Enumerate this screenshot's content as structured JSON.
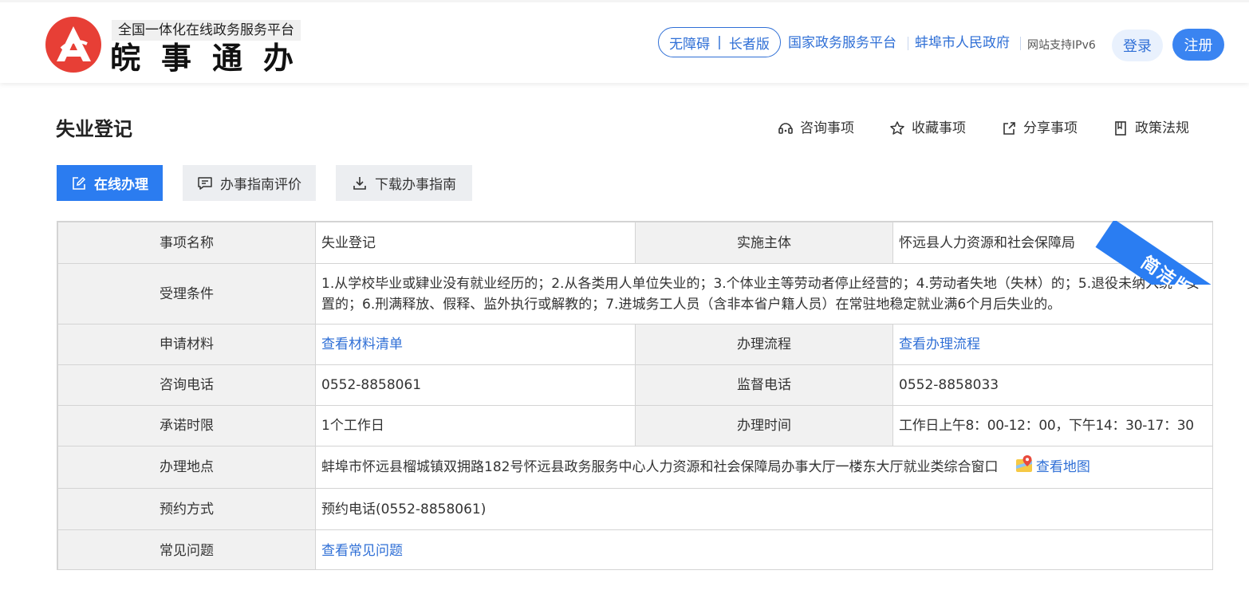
{
  "header": {
    "platform_tag": "全国一体化在线政务服务平台",
    "brand": "皖事通办",
    "accessibility": "无障碍",
    "elder_mode": "长者版",
    "national_platform": "国家政务服务平台",
    "city_gov": "蚌埠市人民政府",
    "ipv6": "网站支持IPv6",
    "login": "登录",
    "register": "注册",
    "brand_color": "#e73f36",
    "accent_color": "#2f6fd6"
  },
  "page": {
    "title": "失业登记",
    "actions": {
      "consult": "咨询事项",
      "favorite": "收藏事项",
      "share": "分享事项",
      "policy": "政策法规"
    },
    "buttons": {
      "online": "在线办理",
      "evaluate": "办事指南评价",
      "download": "下载办事指南"
    },
    "ribbon": "简洁版"
  },
  "table": {
    "item_name_label": "事项名称",
    "item_name": "失业登记",
    "agency_label": "实施主体",
    "agency": "怀远县人力资源和社会保障局",
    "conditions_label": "受理条件",
    "conditions": "1.从学校毕业或肄业没有就业经历的；2.从各类用人单位失业的；3.个体业主等劳动者停止经营的；4.劳动者失地（失林）的；5.退役未纳入统一安置的；6.刑满释放、假释、监外执行或解教的；7.进城务工人员（含非本省户籍人员）在常驻地稳定就业满6个月后失业的。",
    "materials_label": "申请材料",
    "materials_link": "查看材料清单",
    "process_label": "办理流程",
    "process_link": "查看办理流程",
    "consult_phone_label": "咨询电话",
    "consult_phone": "0552-8858061",
    "supervise_phone_label": "监督电话",
    "supervise_phone": "0552-8858033",
    "time_limit_label": "承诺时限",
    "time_limit": "1个工作日",
    "office_hours_label": "办理时间",
    "office_hours": "工作日上午8：00-12：00，下午14：30-17：30",
    "location_label": "办理地点",
    "location": "蚌埠市怀远县榴城镇双拥路182号怀远县政务服务中心人力资源和社会保障局办事大厅一楼东大厅就业类综合窗口",
    "map_link": "查看地图",
    "booking_label": "预约方式",
    "booking": "预约电话(0552-8858061)",
    "faq_label": "常见问题",
    "faq_link": "查看常见问题"
  }
}
